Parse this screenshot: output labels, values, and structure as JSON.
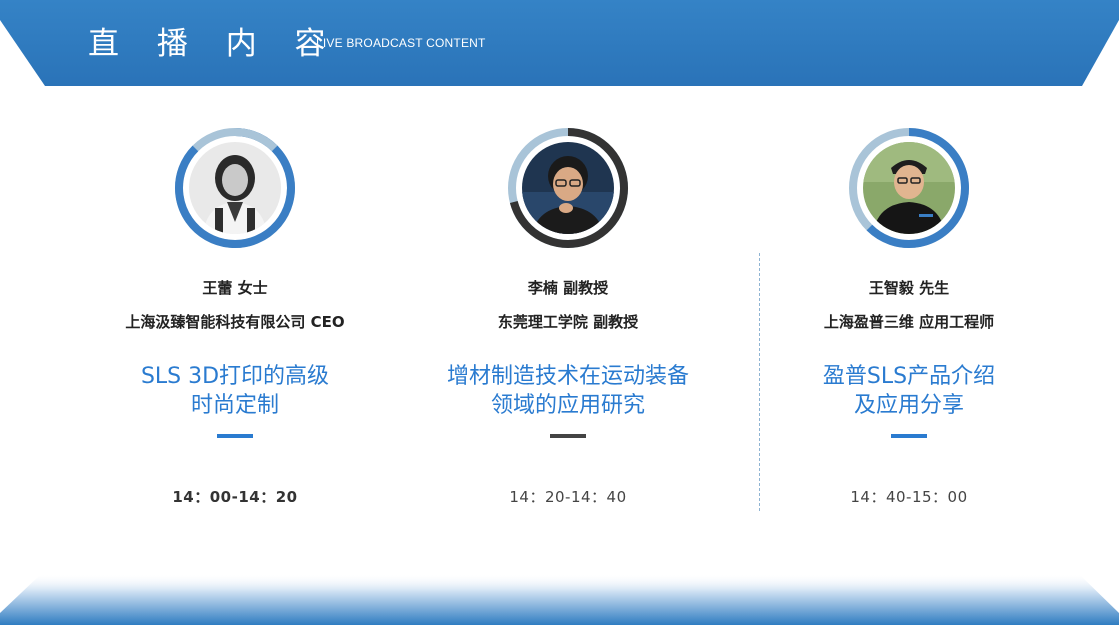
{
  "header": {
    "title": "直 播 内 容",
    "subtitle": "LIVE BROADCAST CONTENT",
    "color": "#2f7cc1"
  },
  "speakers": [
    {
      "name": "王蕾 女士",
      "org": "上海汲臻智能科技有限公司 CEO",
      "talk_lines": [
        "SLS 3D打印的高级",
        "时尚定制"
      ],
      "time": "14：00-14：20",
      "accent_color": "#2a7bd0",
      "ring_colors": [
        "#3a7ec4",
        "#a9c4d8"
      ],
      "avatar": "woman-portrait-icon"
    },
    {
      "name": "李楠 副教授",
      "org": "东莞理工学院 副教授",
      "talk_lines": [
        "增材制造技术在运动装备",
        "领域的应用研究"
      ],
      "time": "14：20-14：40",
      "accent_color": "#444444",
      "ring_colors": [
        "#333333",
        "#a9c4d8"
      ],
      "avatar": "woman-glasses-portrait-icon"
    },
    {
      "name": "王智毅 先生",
      "org": "上海盈普三维 应用工程师",
      "talk_lines": [
        "盈普SLS产品介绍",
        "及应用分享"
      ],
      "time": "14：40-15：00",
      "accent_color": "#2a7bd0",
      "ring_colors": [
        "#3a7ec4",
        "#a9c4d8"
      ],
      "avatar": "man-portrait-icon"
    }
  ]
}
